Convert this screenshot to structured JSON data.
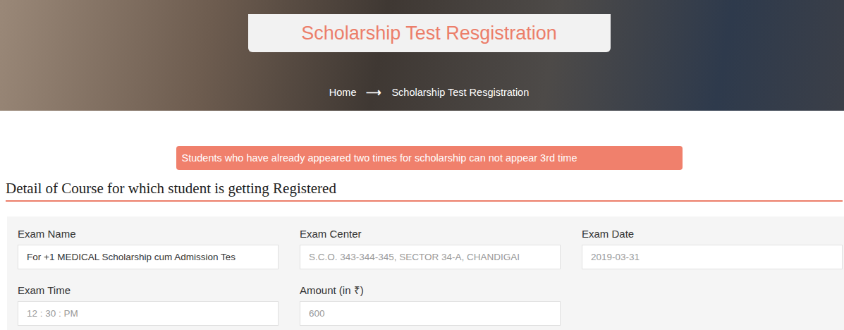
{
  "page": {
    "title": "Scholarship Test Resgistration"
  },
  "breadcrumb": {
    "items": [
      "Home",
      "Scholarship Test Resgistration"
    ],
    "separator": "⟶"
  },
  "alert": "Students who have already appeared two times for scholarship can not appear 3rd time",
  "section": {
    "heading": "Detail of Course for which student is getting Registered"
  },
  "fields": [
    {
      "label": "Exam Name",
      "value": "For +1 MEDICAL Scholarship cum Admission Tes",
      "disabled": false
    },
    {
      "label": "Exam Center",
      "value": "S.C.O. 343-344-345, SECTOR 34-A, CHANDIGAI",
      "disabled": true
    },
    {
      "label": "Exam Date",
      "value": "2019-03-31",
      "disabled": true
    },
    {
      "label": "Exam Time",
      "value": "12 : 30 : PM",
      "disabled": true
    },
    {
      "label": "Amount (in ₹)",
      "value": "600",
      "disabled": true
    }
  ]
}
